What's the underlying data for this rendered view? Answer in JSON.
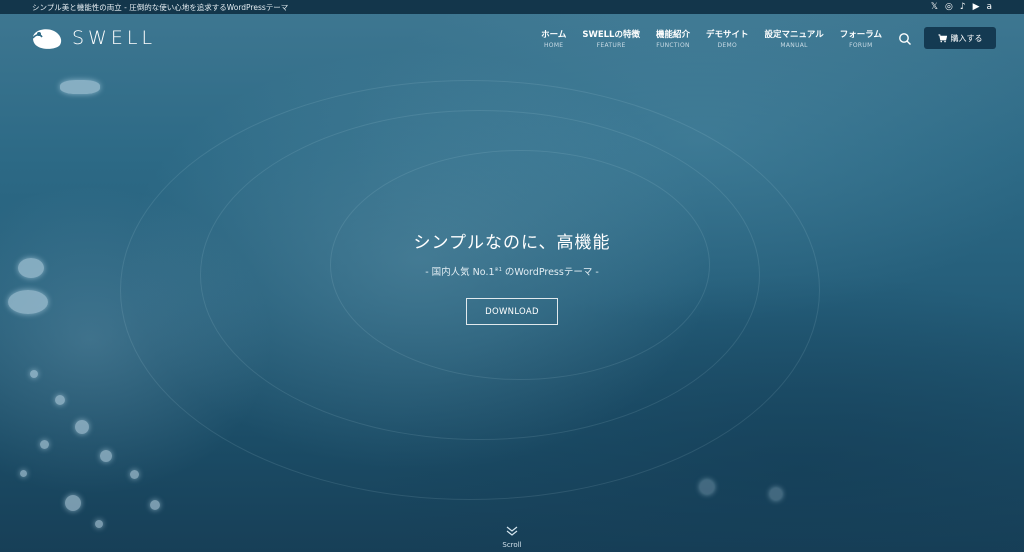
{
  "topbar": {
    "tagline": "シンプル美と機能性の両立 - 圧倒的な使い心地を追求するWordPressテーマ",
    "social": [
      {
        "icon": "x-icon",
        "glyph": "𝕏"
      },
      {
        "icon": "instagram-icon",
        "glyph": "◎"
      },
      {
        "icon": "tiktok-icon",
        "glyph": "♪"
      },
      {
        "icon": "youtube-icon",
        "glyph": "▶"
      },
      {
        "icon": "amazon-icon",
        "glyph": "a"
      }
    ]
  },
  "header": {
    "logo_text": "SWELL",
    "nav": [
      {
        "label": "ホーム",
        "sub": "HOME"
      },
      {
        "label": "SWELLの特徴",
        "sub": "FEATURE"
      },
      {
        "label": "機能紹介",
        "sub": "FUNCTION"
      },
      {
        "label": "デモサイト",
        "sub": "DEMO"
      },
      {
        "label": "設定マニュアル",
        "sub": "MANUAL"
      },
      {
        "label": "フォーラム",
        "sub": "FORUM"
      }
    ],
    "buy_label": "購入する"
  },
  "hero": {
    "title": "シンプルなのに、高機能",
    "subtitle_pre": "- 国内人気 No.1",
    "subtitle_sup": "※1",
    "subtitle_post": " のWordPressテーマ -",
    "button_label": "DOWNLOAD",
    "scroll_label": "Scroll"
  },
  "colors": {
    "topbar": "#13364b",
    "buy_button": "#143a52",
    "water": "#2d6a86"
  }
}
